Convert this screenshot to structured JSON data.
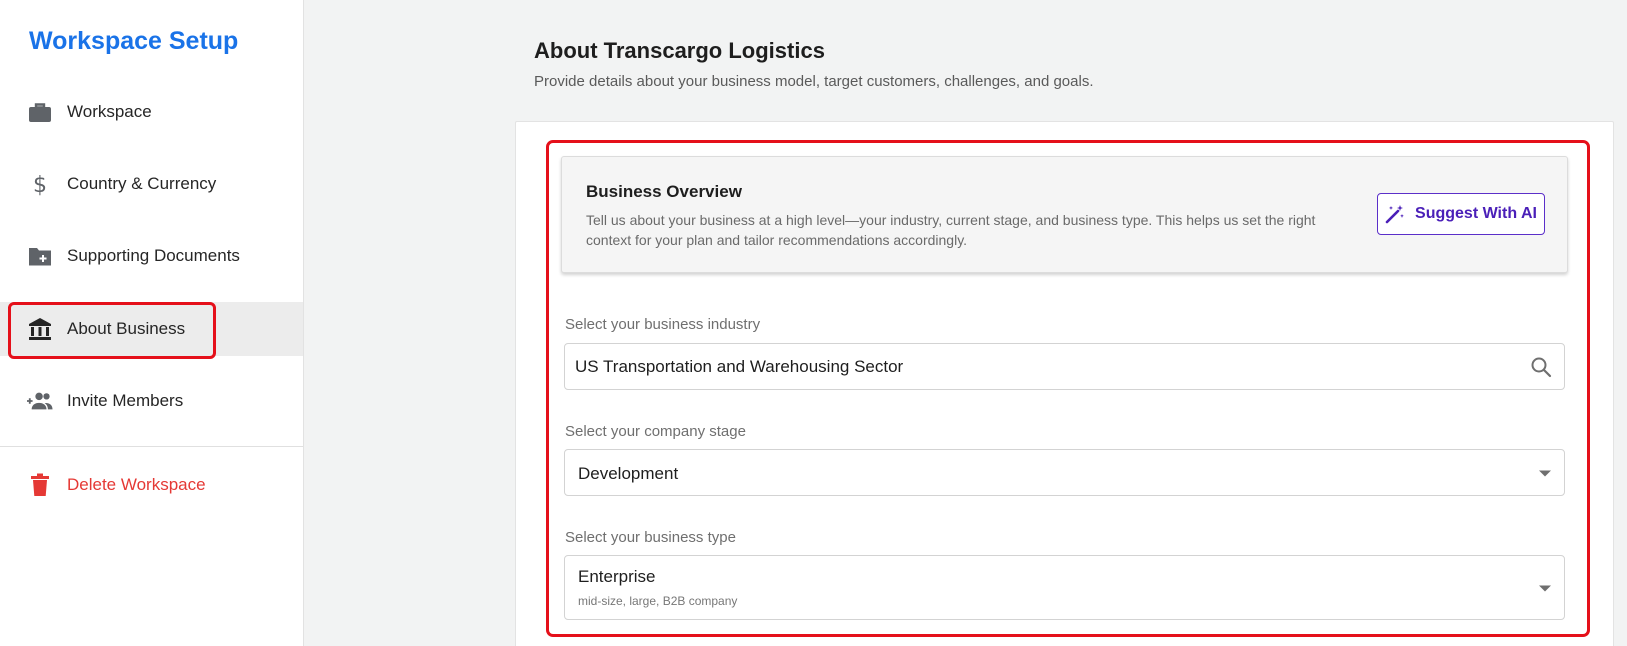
{
  "sidebar": {
    "title": "Workspace Setup",
    "items": [
      {
        "label": "Workspace",
        "icon": "briefcase-icon"
      },
      {
        "label": "Country & Currency",
        "icon": "dollar-icon"
      },
      {
        "label": "Supporting Documents",
        "icon": "folder-plus-icon"
      },
      {
        "label": "About Business",
        "icon": "bank-icon",
        "active": true
      },
      {
        "label": "Invite Members",
        "icon": "add-people-icon"
      }
    ],
    "delete_label": "Delete Workspace",
    "delete_icon": "trash-icon"
  },
  "main": {
    "title": "About Transcargo Logistics",
    "subtitle": "Provide details about your business model, target customers, challenges, and goals."
  },
  "overview": {
    "title": "Business Overview",
    "description": "Tell us about your business at a high level—your industry, current stage, and business type. This helps us set the right context for your plan and tailor recommendations accordingly.",
    "ai_button_label": "Suggest With AI"
  },
  "fields": {
    "industry": {
      "label": "Select your business industry",
      "value": "US Transportation and Warehousing Sector"
    },
    "stage": {
      "label": "Select your company stage",
      "value": "Development"
    },
    "type": {
      "label": "Select your business type",
      "value": "Enterprise",
      "hint": "mid-size, large, B2B company"
    }
  },
  "colors": {
    "brand": "#1a73e8",
    "ai_accent": "#4a1fb8",
    "danger": "#e53935",
    "highlight": "#e5101a"
  }
}
